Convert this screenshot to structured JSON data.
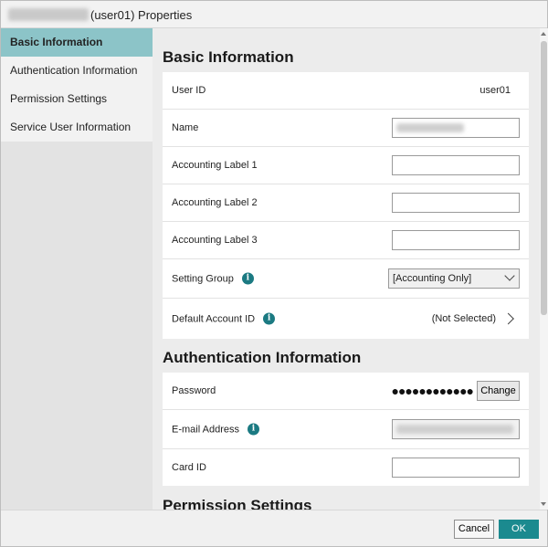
{
  "window": {
    "title_suffix": "(user01) Properties"
  },
  "sidebar": {
    "items": [
      {
        "label": "Basic Information"
      },
      {
        "label": "Authentication Information"
      },
      {
        "label": "Permission Settings"
      },
      {
        "label": "Service User Information"
      }
    ]
  },
  "basic_info": {
    "heading": "Basic Information",
    "user_id_label": "User ID",
    "user_id_value": "user01",
    "name_label": "Name",
    "accounting_label_1": "Accounting Label 1",
    "accounting_label_2": "Accounting Label 2",
    "accounting_label_3": "Accounting Label 3",
    "setting_group_label": "Setting Group",
    "setting_group_value": "[Accounting Only]",
    "default_account_label": "Default Account ID",
    "default_account_value": "(Not Selected)"
  },
  "auth_info": {
    "heading": "Authentication Information",
    "password_label": "Password",
    "password_mask": "●●●●●●●●●●●●",
    "change_label": "Change",
    "email_label": "E-mail Address",
    "card_id_label": "Card ID"
  },
  "permission": {
    "heading": "Permission Settings"
  },
  "footer": {
    "cancel_label": "Cancel",
    "ok_label": "OK"
  },
  "icons": {
    "info": "i"
  },
  "colors": {
    "accent": "#1b8a8f",
    "sidebar_active": "#8cc4c8"
  }
}
